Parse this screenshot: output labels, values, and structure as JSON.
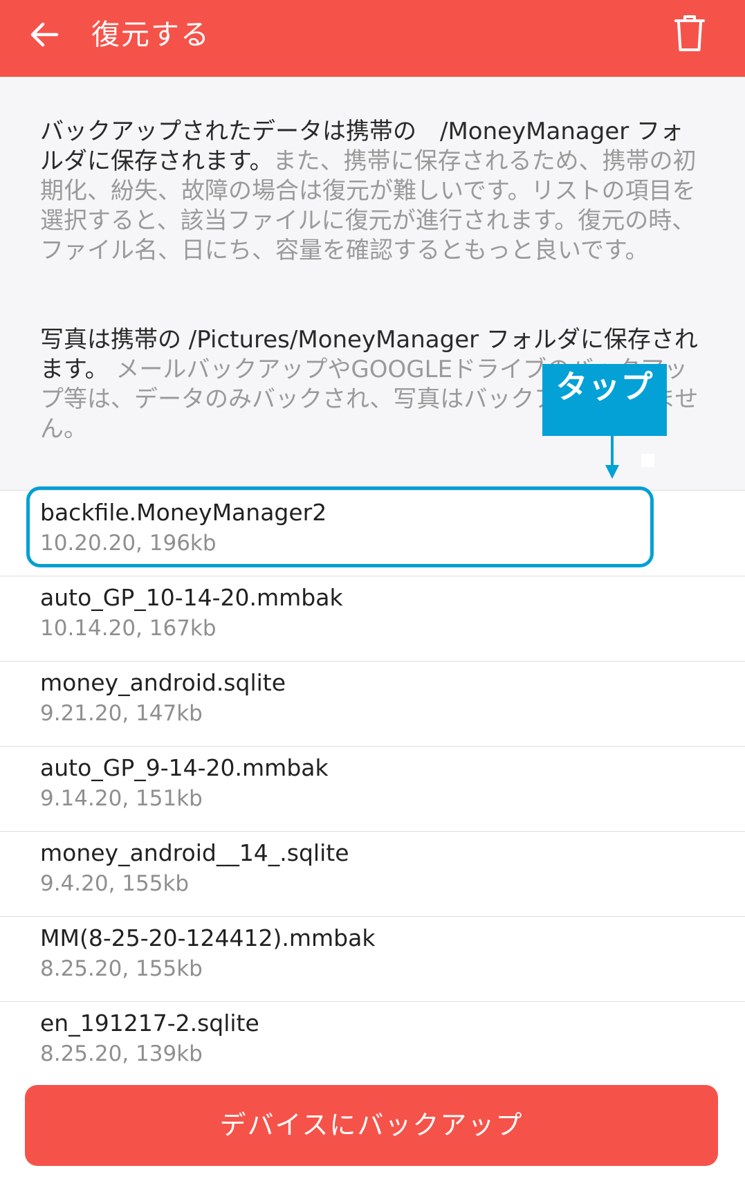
{
  "appbar": {
    "title": "復元する",
    "back_icon": "arrow-left-icon",
    "delete_icon": "trash-icon"
  },
  "info": {
    "p1_dark": "バックアップされたデータは携帯の　/MoneyManager フォルダに保存されます。",
    "p1_light": "また、携帯に保存されるため、携帯の初期化、紛失、故障の場合は復元が難しいです。リストの項目を選択すると、該当ファイルに復元が進行されます。復元の時、ファイル名、日にち、容量を確認するともっと良いです。",
    "p2_dark": "写真は携帯の /Pictures/MoneyManager フォルダに保存されます。",
    "p2_light": " メールバックアップやGOOGLEドライブのバックアップ等は、データのみバックされ、写真はバックアップされません。"
  },
  "callout": {
    "label": "タップ",
    "color": "#03a1d6"
  },
  "files": [
    {
      "name": "backfile.MoneyManager2",
      "meta": "10.20.20, 196kb"
    },
    {
      "name": "auto_GP_10-14-20.mmbak",
      "meta": "10.14.20, 167kb"
    },
    {
      "name": "money_android.sqlite",
      "meta": "9.21.20, 147kb"
    },
    {
      "name": "auto_GP_9-14-20.mmbak",
      "meta": "9.14.20, 151kb"
    },
    {
      "name": "money_android__14_.sqlite",
      "meta": "9.4.20, 155kb"
    },
    {
      "name": "MM(8-25-20-124412).mmbak",
      "meta": "8.25.20, 155kb"
    },
    {
      "name": "en_191217-2.sqlite",
      "meta": "8.25.20, 139kb"
    }
  ],
  "bottom_button": {
    "label": "デバイスにバックアップ"
  },
  "colors": {
    "accent": "#f5534a",
    "highlight": "#039fd5"
  }
}
